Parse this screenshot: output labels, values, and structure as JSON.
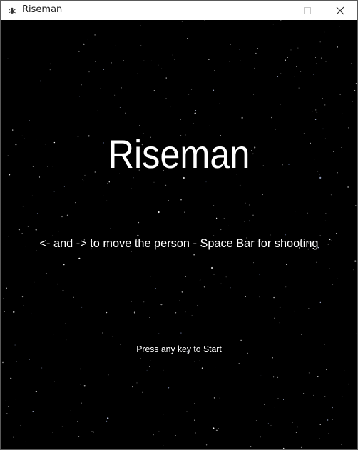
{
  "window": {
    "title": "Riseman",
    "icon": "bug-icon",
    "controls": [
      "minimize-icon",
      "maximize-icon",
      "close-icon"
    ]
  },
  "game": {
    "title": "Riseman",
    "instructions": "<- and -> to move the person - Space Bar for shooting",
    "start_prompt": "Press any key to Start",
    "background_color": "#000000",
    "text_color": "#ffffff"
  }
}
